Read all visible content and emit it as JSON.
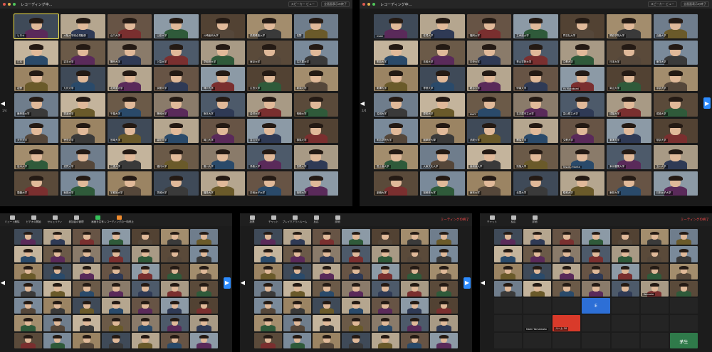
{
  "window": {
    "title": "レコーディング中...",
    "speaker_view": "スピーカー ビュー",
    "fullscreen_exit": "全画面表示の終了"
  },
  "panels": {
    "top_left": {
      "page": "1/4",
      "names": [
        "ヒロキ",
        "大阪大学総合運動部",
        "山口大学",
        "山形大学",
        "川崎医科大学",
        "慶應義塾大学",
        "佐野",
        "江本",
        "岩手大学",
        "関西大学",
        "上智大学",
        "早稲田大学",
        "東京大学",
        "名古屋大学",
        "岩野",
        "九州大学",
        "北海道大学",
        "京都大学",
        "神戸大学",
        "広島大学",
        "新潟大学",
        "鹿児島大学",
        "筑波大学",
        "千葉大学",
        "静岡大学",
        "熊本大学",
        "金沢大学",
        "長崎大学",
        "大分大学",
        "徳島大学",
        "宮崎大学",
        "高知大学",
        "岡山大学",
        "富山大学",
        "群馬大学",
        "信州大学",
        "滋賀大学",
        "三重大学",
        "福井大学",
        "香川大学",
        "鳥取大学",
        "島根大学",
        "愛媛大学",
        "秋田大学",
        "宇都宮大学",
        "茨城大学",
        "福島大学",
        "奈良女子大学",
        "琉球大学"
      ]
    },
    "top_right": {
      "page": "2/4",
      "names": [
        "mobi",
        "佐賀大学",
        "福岡大学",
        "立命館大学",
        "同志社大学",
        "関西学院大学",
        "近畿大学",
        "明治大学",
        "法政大学",
        "中央大学",
        "青山学院大学",
        "立教大学",
        "日本大学",
        "東洋大学",
        "駒澤大学",
        "専修大学",
        "龍谷大学",
        "甲南大学",
        "Yu Murakami",
        "南山大学",
        "中京大学",
        "名城大学",
        "愛知大学",
        "MAFF",
        "名古屋市立大学",
        "富山県立大学",
        "成蹊大学",
        "成城大学",
        "明治学院大学",
        "國學院大學",
        "武蔵大学",
        "獨協大学",
        "文教大学",
        "東海大学",
        "帝京大学",
        "国士舘大学",
        "大東文化大学",
        "亜細亜大学",
        "拓殖大学",
        "Tasuku Morita",
        "東京農業大学",
        "玉川大学",
        "創価大学",
        "桜美林大学",
        "麻布大学",
        "北里大学",
        "昭和大学",
        "東邦大学",
        "日本女子大学"
      ]
    },
    "bottom_left": {
      "names": [
        "参加者"
      ]
    },
    "bottom_mid": {
      "names": [
        "参加者"
      ]
    },
    "bottom_right": {
      "names": [
        "E",
        "Kensuke",
        "ルーム 10",
        "Nami Yamamoto",
        "茅生"
      ]
    }
  },
  "toolbar": {
    "mute": "ミュート解除",
    "video": "ビデオの開始",
    "security": "セキュリティ",
    "participants": "参加者の管理",
    "polls": "投票",
    "chat": "チャット",
    "share": "画面を共有",
    "record": "レコーディングの一時停止",
    "breakout": "ブレイクアウトルーム",
    "reactions": "反応",
    "more": "詳細",
    "end": "ミーティングの終了"
  },
  "colors": {
    "accent_blue": "#2d8cff",
    "end_red": "#ff4b4b",
    "active_yellow": "#f2e44b"
  }
}
